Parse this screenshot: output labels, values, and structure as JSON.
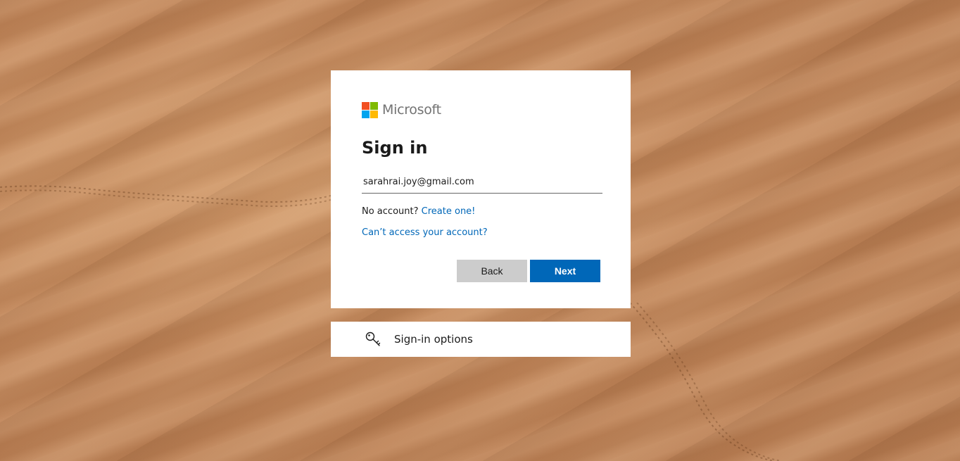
{
  "brand": {
    "name": "Microsoft",
    "colors": {
      "red": "#f25022",
      "green": "#7fba00",
      "blue": "#00a4ef",
      "yellow": "#ffb900"
    }
  },
  "signin": {
    "title": "Sign in",
    "email_value": "sarahrai.joy@gmail.com",
    "no_account_text": "No account?",
    "create_link": "Create one!",
    "cant_access_link": "Can’t access your account?",
    "back_label": "Back",
    "next_label": "Next"
  },
  "options": {
    "icon": "key-icon",
    "label": "Sign-in options"
  },
  "colors": {
    "accent": "#0067b8",
    "back_button": "#cccccc"
  }
}
